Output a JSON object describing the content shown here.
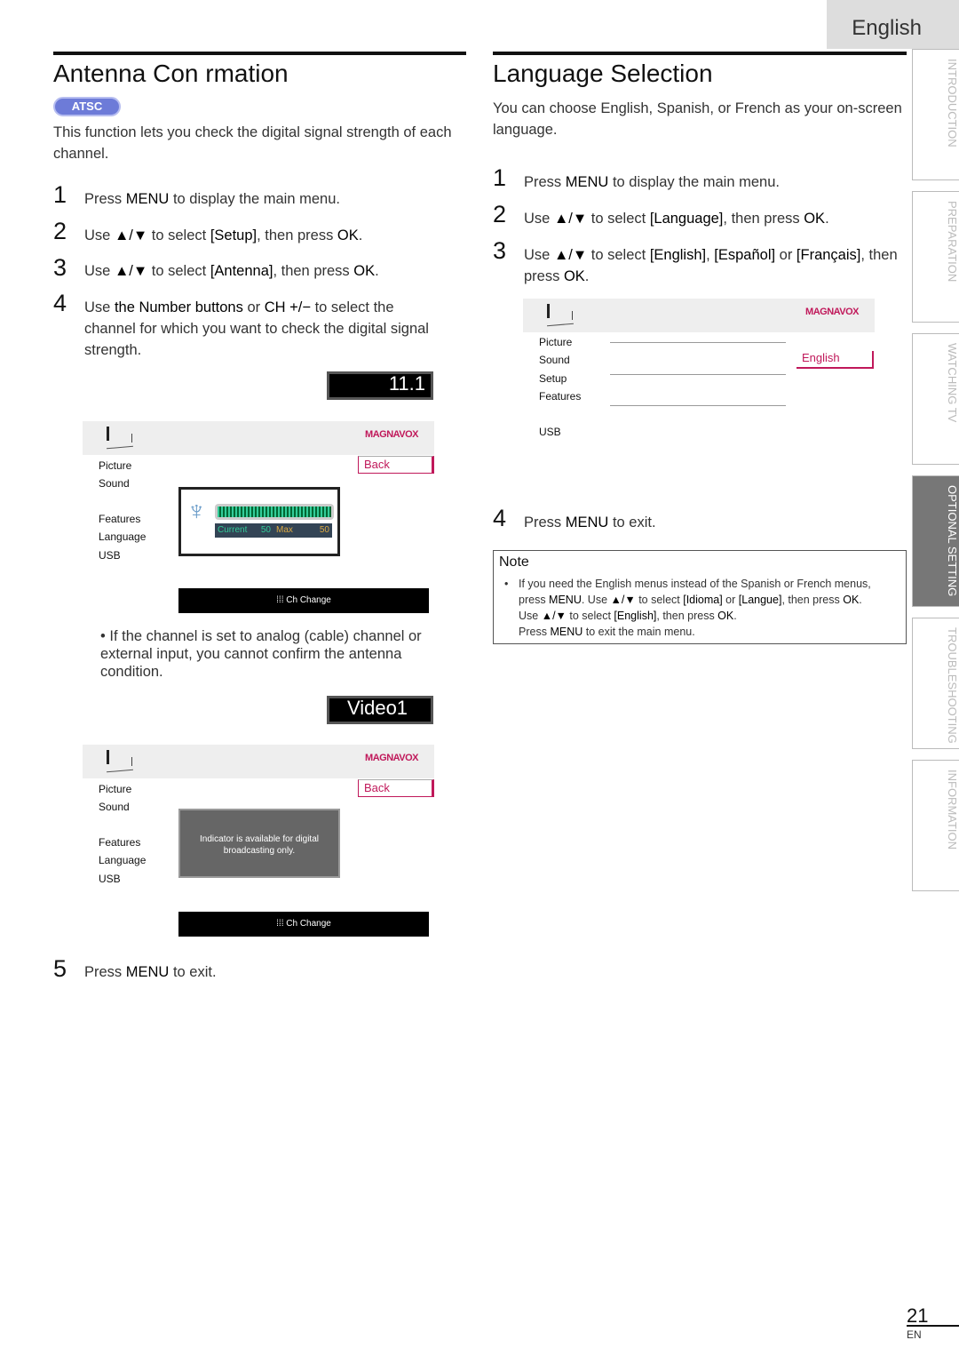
{
  "header": {
    "language_tab": "English"
  },
  "side_tabs": [
    {
      "label": "INTRODUCTION",
      "active": false
    },
    {
      "label": "PREPARATION",
      "active": false
    },
    {
      "label": "WATCHING TV",
      "active": false
    },
    {
      "label": "OPTIONAL SETTING",
      "active": true
    },
    {
      "label": "TROUBLESHOOTING",
      "active": false
    },
    {
      "label": "INFORMATION",
      "active": false
    }
  ],
  "left": {
    "title": "Antenna Con  rmation",
    "badge": "ATSC",
    "intro": "This function lets you check the digital signal strength of each channel.",
    "steps": [
      {
        "n": "1",
        "pre": "Press ",
        "b1": "MENU",
        "post": " to display the main menu."
      },
      {
        "n": "2",
        "pre": "Use ",
        "b1": "▲/▼",
        "mid": " to select ",
        "b2": "[Setup]",
        "post": ", then press ",
        "b3": "OK",
        "end": "."
      },
      {
        "n": "3",
        "pre": "Use ",
        "b1": "▲/▼",
        "mid": " to select ",
        "b2": "[Antenna]",
        "post": ", then press ",
        "b3": "OK",
        "end": "."
      },
      {
        "n": "4",
        "pre": "Use ",
        "b1": "the Number buttons",
        "mid": " or ",
        "b2": "CH +/−",
        "post": "  to select the channel for which you want to check the digital signal strength."
      },
      {
        "n": "5",
        "pre": "Press ",
        "b1": "MENU",
        "post": " to exit."
      }
    ],
    "bullet": "If the channel is set to analog (cable) channel or external input, you cannot confirm the antenna condition.",
    "screen1": {
      "channel": "11.1",
      "logo": "MAGNAVOX",
      "menu": [
        "Picture",
        "Sound",
        "Features",
        "Language",
        "USB"
      ],
      "back": "Back",
      "current_label": "Current",
      "current": "50",
      "max_label": "Max",
      "max": "50",
      "footer": "Ch Change"
    },
    "screen2": {
      "channel": "Video1",
      "logo": "MAGNAVOX",
      "menu": [
        "Picture",
        "Sound",
        "Features",
        "Language",
        "USB"
      ],
      "back": "Back",
      "message": "Indicator is available for digital broadcasting only.",
      "footer": "Ch Change"
    }
  },
  "right": {
    "title": "Language Selection",
    "intro": "You can choose English, Spanish, or French as your on-screen language.",
    "steps": [
      {
        "n": "1",
        "pre": "Press ",
        "b1": "MENU",
        "post": " to display the main menu."
      },
      {
        "n": "2",
        "pre": "Use ",
        "b1": "▲/▼",
        "mid": " to select ",
        "b2": "[Language]",
        "post": ", then press ",
        "b3": "OK",
        "end": "."
      },
      {
        "n": "3",
        "pre": "Use ",
        "b1": "▲/▼",
        "mid": " to select ",
        "b2": "[English]",
        "m2": ", ",
        "b4": "[Español]",
        "m3": " or ",
        "b5": "[Français]",
        "post": ", then press ",
        "b3": "OK",
        "end": "."
      },
      {
        "n": "4",
        "pre": "Press ",
        "b1": "MENU",
        "post": " to exit."
      }
    ],
    "screen": {
      "logo": "MAGNAVOX",
      "menu": [
        "Picture",
        "Sound",
        "Setup",
        "Features",
        "USB"
      ],
      "selected": "English"
    },
    "note": {
      "title": "Note",
      "l1a": "If you need the English menus instead of the Spanish or French menus, press ",
      "l1b": "MENU",
      "l1c": ". Use ",
      "l1d": "▲/▼",
      "l1e": " to select ",
      "l1f": "[Idioma]",
      "l1g": " or ",
      "l1h": "[Langue]",
      "l1i": ", then press ",
      "l1j": "OK",
      "l1k": ".",
      "l2a": "Use ",
      "l2b": "▲/▼",
      "l2c": " to select ",
      "l2d": "[English]",
      "l2e": ", then press ",
      "l2f": "OK",
      "l2g": ".",
      "l3a": "Press ",
      "l3b": "MENU",
      "l3c": " to exit the main menu."
    }
  },
  "footer": {
    "page": "21",
    "lang": "EN"
  },
  "colors": {
    "accent": "#c0185a",
    "badge": "#6d7bd8",
    "active_tab": "#777777"
  }
}
